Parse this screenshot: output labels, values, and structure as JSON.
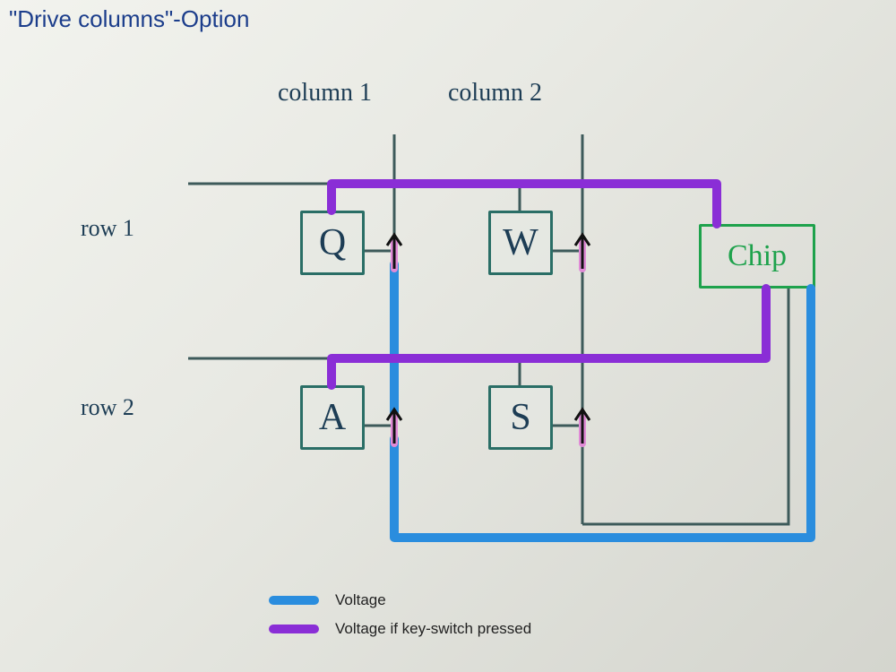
{
  "title": "\"Drive columns\"-Option",
  "labels": {
    "col1": "column 1",
    "col2": "column 2",
    "row1": "row 1",
    "row2": "row 2",
    "chip": "Chip"
  },
  "keys": {
    "q": "Q",
    "w": "W",
    "a": "A",
    "s": "S"
  },
  "legend": {
    "blue": "Voltage",
    "purple": "Voltage if key-switch pressed"
  },
  "colors": {
    "voltage": "#2a8dde",
    "voltage_pressed": "#8a2ed6",
    "wire": "#3d5a5a",
    "key_border": "#2a6e66",
    "chip_border": "#1ea24c",
    "title": "#1b3d8b"
  },
  "diagram": {
    "description": "Keyboard matrix 'drive columns' scan option. Chip drives column 1 (blue). If Q or A key-switch is pressed, voltage appears on the corresponding row line (purple) which the chip reads.",
    "columns": [
      "column 1",
      "column 2"
    ],
    "rows": [
      "row 1",
      "row 2"
    ],
    "switches": [
      {
        "key": "Q",
        "row": 1,
        "column": 1
      },
      {
        "key": "W",
        "row": 1,
        "column": 2
      },
      {
        "key": "A",
        "row": 2,
        "column": 1
      },
      {
        "key": "S",
        "row": 2,
        "column": 2
      }
    ],
    "driven_column": 1,
    "sensed_rows": [
      1,
      2
    ]
  }
}
